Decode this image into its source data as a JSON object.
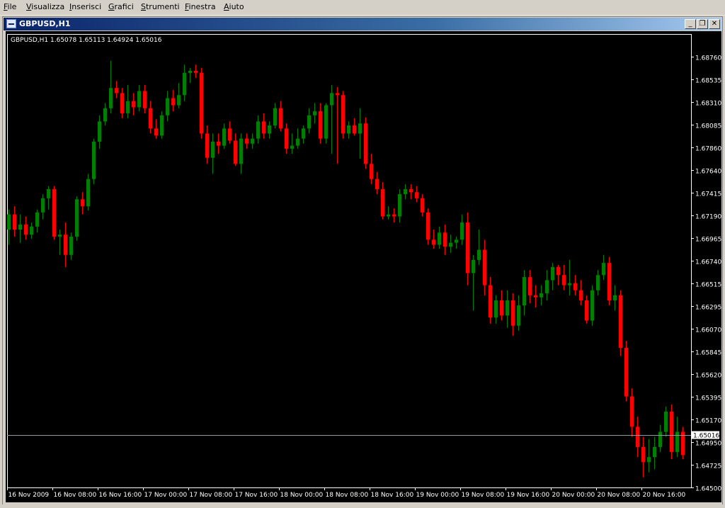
{
  "menu": {
    "items": [
      {
        "label": "File",
        "u": "F",
        "rest": "ile"
      },
      {
        "label": "Visualizza",
        "u": "V",
        "rest": "isualizza"
      },
      {
        "label": "Inserisci",
        "u": "I",
        "rest": "nserisci"
      },
      {
        "label": "Grafici",
        "u": "G",
        "rest": "rafici"
      },
      {
        "label": "Strumenti",
        "u": "S",
        "rest": "trumenti"
      },
      {
        "label": "Finestra",
        "u": "F",
        "rest": "inestra"
      },
      {
        "label": "Aiuto",
        "u": "A",
        "rest": "iuto"
      }
    ]
  },
  "window": {
    "title": "GBPUSD,H1",
    "minimize_glyph": "_",
    "restore_glyph": "❐",
    "close_glyph": "✕"
  },
  "chart_data": {
    "type": "candlestick",
    "info_line": "GBPUSD,H1  1.65078 1.65113 1.64924 1.65016",
    "current_price": "1.65016",
    "y_ticks": [
      "1.68760",
      "1.68535",
      "1.68310",
      "1.68085",
      "1.67860",
      "1.67640",
      "1.67415",
      "1.67190",
      "1.66965",
      "1.66740",
      "1.66515",
      "1.66295",
      "1.66070",
      "1.65845",
      "1.65620",
      "1.65395",
      "1.65170",
      "1.64950",
      "1.64725",
      "1.64500"
    ],
    "ylim": [
      1.645,
      1.6876
    ],
    "x_ticks": [
      "16 Nov 2009",
      "16 Nov 08:00",
      "16 Nov 16:00",
      "17 Nov 00:00",
      "17 Nov 08:00",
      "17 Nov 16:00",
      "18 Nov 00:00",
      "18 Nov 08:00",
      "18 Nov 16:00",
      "19 Nov 00:00",
      "19 Nov 08:00",
      "19 Nov 16:00",
      "20 Nov 00:00",
      "20 Nov 08:00",
      "20 Nov 16:00"
    ],
    "colors": {
      "background": "#000000",
      "bull": "#008000",
      "bear": "#ff0000",
      "axis": "#ffffff",
      "price_line": "#8c9aa3",
      "price_label_bg": "#ffffff"
    },
    "candles": [
      [
        1.6705,
        1.6725,
        1.669,
        1.672
      ],
      [
        1.672,
        1.6728,
        1.6698,
        1.6705
      ],
      [
        1.6705,
        1.672,
        1.6692,
        1.671
      ],
      [
        1.671,
        1.6718,
        1.6695,
        1.67
      ],
      [
        1.67,
        1.6712,
        1.6696,
        1.6708
      ],
      [
        1.6708,
        1.6725,
        1.6702,
        1.6722
      ],
      [
        1.6722,
        1.674,
        1.6715,
        1.6736
      ],
      [
        1.6736,
        1.6748,
        1.6725,
        1.6745
      ],
      [
        1.6745,
        1.6748,
        1.6695,
        1.6698
      ],
      [
        1.6698,
        1.6705,
        1.668,
        1.67
      ],
      [
        1.67,
        1.6712,
        1.6668,
        1.668
      ],
      [
        1.668,
        1.6702,
        1.6675,
        1.6698
      ],
      [
        1.6698,
        1.6738,
        1.6694,
        1.6735
      ],
      [
        1.6735,
        1.6742,
        1.672,
        1.6728
      ],
      [
        1.6728,
        1.676,
        1.6724,
        1.6755
      ],
      [
        1.6755,
        1.6795,
        1.675,
        1.6792
      ],
      [
        1.6792,
        1.6818,
        1.6785,
        1.6812
      ],
      [
        1.6812,
        1.683,
        1.6808,
        1.6825
      ],
      [
        1.6825,
        1.6872,
        1.682,
        1.6845
      ],
      [
        1.6845,
        1.6852,
        1.6835,
        1.684
      ],
      [
        1.684,
        1.6845,
        1.6815,
        1.682
      ],
      [
        1.682,
        1.6848,
        1.6815,
        1.6832
      ],
      [
        1.6832,
        1.684,
        1.6818,
        1.6826
      ],
      [
        1.6826,
        1.6848,
        1.6822,
        1.6842
      ],
      [
        1.6842,
        1.6848,
        1.682,
        1.6825
      ],
      [
        1.6825,
        1.6832,
        1.68,
        1.6805
      ],
      [
        1.6805,
        1.6814,
        1.6795,
        1.6798
      ],
      [
        1.6798,
        1.6822,
        1.6795,
        1.6818
      ],
      [
        1.6818,
        1.6842,
        1.6812,
        1.6835
      ],
      [
        1.6835,
        1.6843,
        1.6822,
        1.6828
      ],
      [
        1.6828,
        1.685,
        1.6825,
        1.6838
      ],
      [
        1.6838,
        1.6868,
        1.6832,
        1.686
      ],
      [
        1.686,
        1.6865,
        1.685,
        1.6862
      ],
      [
        1.6862,
        1.6868,
        1.6855,
        1.686
      ],
      [
        1.686,
        1.6865,
        1.6795,
        1.68
      ],
      [
        1.68,
        1.6808,
        1.677,
        1.6776
      ],
      [
        1.6776,
        1.68,
        1.676,
        1.6792
      ],
      [
        1.6792,
        1.68,
        1.678,
        1.6788
      ],
      [
        1.6788,
        1.681,
        1.6785,
        1.6805
      ],
      [
        1.6805,
        1.6812,
        1.679,
        1.6793
      ],
      [
        1.6793,
        1.68,
        1.6768,
        1.677
      ],
      [
        1.677,
        1.68,
        1.676,
        1.6795
      ],
      [
        1.6795,
        1.68,
        1.6785,
        1.679
      ],
      [
        1.679,
        1.68,
        1.6785,
        1.6795
      ],
      [
        1.6795,
        1.6818,
        1.679,
        1.6812
      ],
      [
        1.6812,
        1.682,
        1.6795,
        1.68
      ],
      [
        1.68,
        1.6812,
        1.6795,
        1.6808
      ],
      [
        1.6808,
        1.683,
        1.6805,
        1.6825
      ],
      [
        1.6825,
        1.6832,
        1.6802,
        1.6805
      ],
      [
        1.6805,
        1.681,
        1.678,
        1.6785
      ],
      [
        1.6785,
        1.68,
        1.678,
        1.6788
      ],
      [
        1.6788,
        1.6805,
        1.6785,
        1.6795
      ],
      [
        1.6795,
        1.6808,
        1.679,
        1.6805
      ],
      [
        1.6805,
        1.6825,
        1.68,
        1.6818
      ],
      [
        1.6818,
        1.683,
        1.681,
        1.6822
      ],
      [
        1.6822,
        1.683,
        1.679,
        1.6795
      ],
      [
        1.6795,
        1.683,
        1.679,
        1.6828
      ],
      [
        1.6828,
        1.6848,
        1.678,
        1.684
      ],
      [
        1.684,
        1.6846,
        1.677,
        1.6838
      ],
      [
        1.6838,
        1.6842,
        1.6795,
        1.68
      ],
      [
        1.68,
        1.6812,
        1.6795,
        1.6808
      ],
      [
        1.6808,
        1.6815,
        1.6798,
        1.68
      ],
      [
        1.68,
        1.6825,
        1.6775,
        1.681
      ],
      [
        1.681,
        1.6816,
        1.6765,
        1.677
      ],
      [
        1.677,
        1.678,
        1.675,
        1.6755
      ],
      [
        1.6755,
        1.6762,
        1.674,
        1.6745
      ],
      [
        1.6745,
        1.6752,
        1.6715,
        1.6718
      ],
      [
        1.6718,
        1.6728,
        1.6715,
        1.672
      ],
      [
        1.672,
        1.6726,
        1.6712,
        1.6718
      ],
      [
        1.6718,
        1.6745,
        1.6712,
        1.674
      ],
      [
        1.674,
        1.675,
        1.6735,
        1.6745
      ],
      [
        1.6745,
        1.675,
        1.6735,
        1.6742
      ],
      [
        1.6742,
        1.6748,
        1.6732,
        1.6736
      ],
      [
        1.6736,
        1.674,
        1.6718,
        1.6722
      ],
      [
        1.6722,
        1.6726,
        1.669,
        1.6695
      ],
      [
        1.6695,
        1.6705,
        1.6686,
        1.669
      ],
      [
        1.669,
        1.6708,
        1.6686,
        1.6702
      ],
      [
        1.6702,
        1.671,
        1.668,
        1.6688
      ],
      [
        1.6688,
        1.67,
        1.6682,
        1.6692
      ],
      [
        1.6692,
        1.6698,
        1.6686,
        1.6695
      ],
      [
        1.6695,
        1.672,
        1.669,
        1.6712
      ],
      [
        1.6712,
        1.6722,
        1.665,
        1.6662
      ],
      [
        1.6662,
        1.668,
        1.6625,
        1.6675
      ],
      [
        1.6675,
        1.6705,
        1.667,
        1.6685
      ],
      [
        1.6685,
        1.6695,
        1.664,
        1.665
      ],
      [
        1.665,
        1.6658,
        1.6612,
        1.6618
      ],
      [
        1.6618,
        1.664,
        1.6612,
        1.6635
      ],
      [
        1.6635,
        1.6645,
        1.6615,
        1.662
      ],
      [
        1.662,
        1.6645,
        1.6608,
        1.6635
      ],
      [
        1.6635,
        1.6642,
        1.66,
        1.661
      ],
      [
        1.661,
        1.664,
        1.6605,
        1.663
      ],
      [
        1.663,
        1.6665,
        1.662,
        1.6658
      ],
      [
        1.6658,
        1.6665,
        1.6632,
        1.664
      ],
      [
        1.664,
        1.665,
        1.6628,
        1.6638
      ],
      [
        1.6638,
        1.665,
        1.663,
        1.6642
      ],
      [
        1.6642,
        1.6665,
        1.6635,
        1.6655
      ],
      [
        1.6655,
        1.6672,
        1.6645,
        1.6668
      ],
      [
        1.6668,
        1.667,
        1.665,
        1.666
      ],
      [
        1.666,
        1.667,
        1.6645,
        1.665
      ],
      [
        1.665,
        1.6675,
        1.664,
        1.6652
      ],
      [
        1.6652,
        1.666,
        1.664,
        1.6645
      ],
      [
        1.6645,
        1.6655,
        1.663,
        1.6635
      ],
      [
        1.6635,
        1.664,
        1.6612,
        1.6615
      ],
      [
        1.6615,
        1.665,
        1.661,
        1.6645
      ],
      [
        1.6645,
        1.6665,
        1.664,
        1.666
      ],
      [
        1.666,
        1.668,
        1.6655,
        1.6672
      ],
      [
        1.6672,
        1.6678,
        1.663,
        1.6635
      ],
      [
        1.6635,
        1.665,
        1.6625,
        1.664
      ],
      [
        1.664,
        1.6645,
        1.658,
        1.6588
      ],
      [
        1.6588,
        1.6595,
        1.6535,
        1.654
      ],
      [
        1.654,
        1.6548,
        1.65,
        1.651
      ],
      [
        1.651,
        1.652,
        1.648,
        1.649
      ],
      [
        1.649,
        1.65,
        1.646,
        1.6475
      ],
      [
        1.6475,
        1.6498,
        1.6465,
        1.648
      ],
      [
        1.648,
        1.65,
        1.6468,
        1.649
      ],
      [
        1.649,
        1.6512,
        1.6485,
        1.6505
      ],
      [
        1.6505,
        1.653,
        1.65,
        1.6525
      ],
      [
        1.6525,
        1.6532,
        1.6478,
        1.6485
      ],
      [
        1.6485,
        1.652,
        1.648,
        1.6505
      ],
      [
        1.6505,
        1.651,
        1.6478,
        1.6482
      ],
      [
        1.6482,
        1.6505,
        1.6472,
        1.65
      ],
      [
        1.65,
        1.6512,
        1.6475,
        1.6502
      ],
      [
        1.6502,
        1.6511,
        1.6492,
        1.6502
      ]
    ]
  }
}
